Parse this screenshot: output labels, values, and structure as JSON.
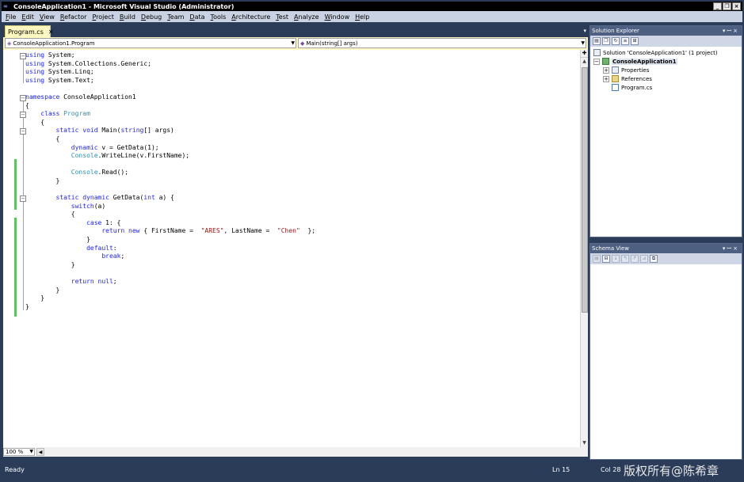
{
  "window": {
    "title": "ConsoleApplication1 - Microsoft Visual Studio (Administrator)",
    "app_icon": "visual-studio-icon"
  },
  "menu": [
    "File",
    "Edit",
    "View",
    "Refactor",
    "Project",
    "Build",
    "Debug",
    "Team",
    "Data",
    "Tools",
    "Architecture",
    "Test",
    "Analyze",
    "Window",
    "Help"
  ],
  "editor": {
    "tab_label": "Program.cs",
    "nav_left": "ConsoleApplication1.Program",
    "nav_right": "Main(string[] args)",
    "zoom": "100 %"
  },
  "code_lines": [
    [
      [
        "kw",
        "using"
      ],
      [
        "",
        "System;"
      ]
    ],
    [
      [
        "kw",
        "using"
      ],
      [
        "",
        "System.Collections.Generic;"
      ]
    ],
    [
      [
        "kw",
        "using"
      ],
      [
        "",
        "System.Linq;"
      ]
    ],
    [
      [
        "kw",
        "using"
      ],
      [
        "",
        "System.Text;"
      ]
    ],
    [],
    [
      [
        "kw",
        "namespace"
      ],
      [
        "",
        "ConsoleApplication1"
      ]
    ],
    [
      [
        "",
        "{"
      ]
    ],
    [
      [
        "",
        "    "
      ],
      [
        "kw",
        "class"
      ],
      [
        "ty",
        "Program"
      ]
    ],
    [
      [
        "",
        "    {"
      ]
    ],
    [
      [
        "",
        "        "
      ],
      [
        "kw",
        "static"
      ],
      [
        "kw",
        "void"
      ],
      [
        "",
        "Main("
      ],
      [
        "kw",
        "string"
      ],
      [
        "",
        "[] args)"
      ]
    ],
    [
      [
        "",
        "        {"
      ]
    ],
    [
      [
        "",
        "            "
      ],
      [
        "kw",
        "dynamic"
      ],
      [
        "",
        "v = GetData(1);"
      ]
    ],
    [
      [
        "",
        "            "
      ],
      [
        "ty",
        "Console"
      ],
      [
        "",
        ".WriteLine(v.FirstName);"
      ]
    ],
    [],
    [
      [
        "",
        "            "
      ],
      [
        "ty",
        "Console"
      ],
      [
        "",
        ".Read();"
      ]
    ],
    [
      [
        "",
        "        }"
      ]
    ],
    [],
    [
      [
        "",
        "        "
      ],
      [
        "kw",
        "static"
      ],
      [
        "kw",
        "dynamic"
      ],
      [
        "",
        "GetData("
      ],
      [
        "kw",
        "int"
      ],
      [
        "",
        "a) {"
      ]
    ],
    [
      [
        "",
        "            "
      ],
      [
        "kw",
        "switch"
      ],
      [
        "",
        "(a)"
      ]
    ],
    [
      [
        "",
        "            {"
      ]
    ],
    [
      [
        "",
        "                "
      ],
      [
        "kw",
        "case"
      ],
      [
        "",
        "1: {"
      ]
    ],
    [
      [
        "",
        "                    "
      ],
      [
        "kw",
        "return"
      ],
      [
        "kw",
        "new"
      ],
      [
        "",
        "{ FirstName = "
      ],
      [
        "st",
        "\"ARES\""
      ],
      [
        "",
        ", LastName = "
      ],
      [
        "st",
        "\"Chen\""
      ],
      [
        "",
        " };"
      ]
    ],
    [
      [
        "",
        "                }"
      ]
    ],
    [
      [
        "",
        "                "
      ],
      [
        "kw",
        "default"
      ],
      [
        "",
        ":"
      ]
    ],
    [
      [
        "",
        "                    "
      ],
      [
        "kw",
        "break"
      ],
      [
        "",
        ";"
      ]
    ],
    [
      [
        "",
        "            }"
      ]
    ],
    [],
    [
      [
        "",
        "            "
      ],
      [
        "kw",
        "return"
      ],
      [
        "kw",
        "null"
      ],
      [
        "",
        ";"
      ]
    ],
    [
      [
        "",
        "        }"
      ]
    ],
    [
      [
        "",
        "    }"
      ]
    ],
    [
      [
        "",
        "}"
      ]
    ]
  ],
  "solution_explorer": {
    "title": "Solution Explorer",
    "solution": "Solution 'ConsoleApplication1' (1 project)",
    "project": "ConsoleApplication1",
    "items": [
      "Properties",
      "References",
      "Program.cs"
    ]
  },
  "schema_view": {
    "title": "Schema View"
  },
  "status": {
    "ready": "Ready",
    "line": "Ln 15",
    "col": "Col 28",
    "watermark": "版权所有@陈希章"
  },
  "colors": {
    "keyword": "#1f23ff",
    "type": "#2b91af",
    "string": "#a31515",
    "chrome": "#2b3c59",
    "tab": "#fff8c0",
    "change_marker": "#5ec35e"
  }
}
